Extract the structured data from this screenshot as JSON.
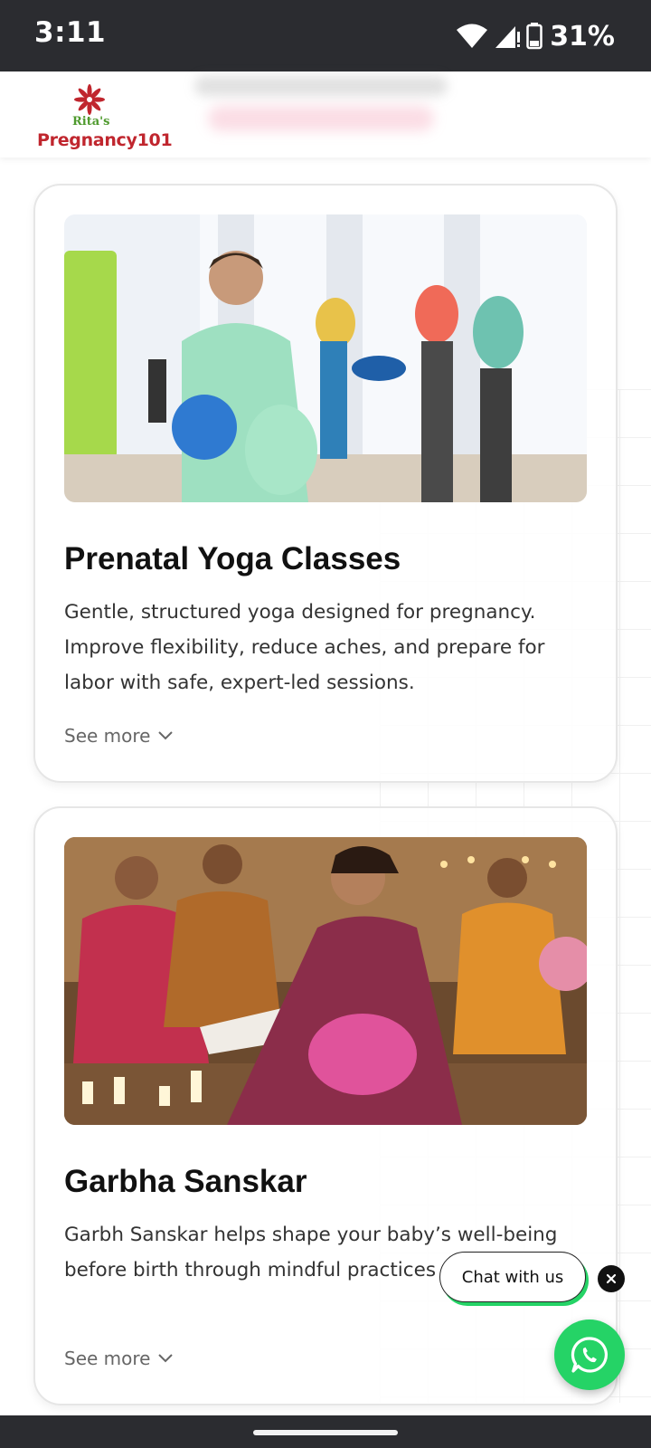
{
  "status_bar": {
    "time": "3:11",
    "battery": "31%",
    "icons": [
      "wifi-icon",
      "cell-signal-icon",
      "battery-icon"
    ]
  },
  "header": {
    "logo_top": "Rita's",
    "logo_main": "Pregnancy101"
  },
  "cards": [
    {
      "title": "Prenatal Yoga Classes",
      "description": "Gentle, structured yoga designed for pregnancy. Improve flexibility, reduce aches, and prepare for labor with safe, expert-led sessions.",
      "see_more": "See more"
    },
    {
      "title": "Garbha Sanskar",
      "description": "Garbh Sanskar helps shape your baby’s well-being before birth through mindful practices and habits.",
      "see_more": "See more"
    }
  ],
  "chat": {
    "label": "Chat with us",
    "close_icon": "close-icon",
    "whatsapp_icon": "whatsapp-icon"
  },
  "colors": {
    "accent_green": "#25d366",
    "brand_red": "#c0262e",
    "status_bar_bg": "#2b2c30"
  }
}
